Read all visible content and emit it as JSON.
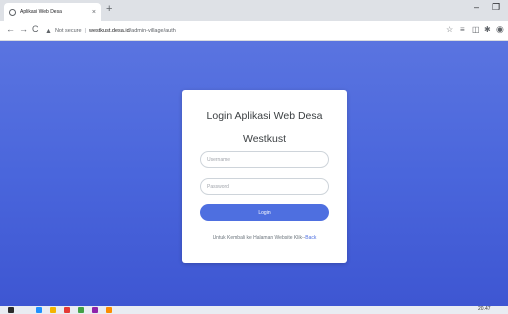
{
  "tab": {
    "title": "Aplikasi Web Desa",
    "close": "×",
    "new_tab": "+"
  },
  "window": {
    "minimize": "–",
    "restore": "❐"
  },
  "toolbar": {
    "back": "←",
    "forward": "→",
    "reload": "C",
    "security_icon": "▲",
    "security_text": "Not secure",
    "url_host": "westkust.desa.id",
    "url_path": "/admin-village/auth",
    "icons": [
      "star-icon",
      "media-icon",
      "extension-icon",
      "puzzle-icon",
      "profile-icon"
    ]
  },
  "login": {
    "title_line1": "Login Aplikasi Web Desa",
    "title_line2": "Westkust",
    "username_placeholder": "Username",
    "password_placeholder": "Password",
    "login_button": "Login",
    "back_text": "Untuk Kembali ke Halaman Website Klik--",
    "back_link": "Back"
  },
  "taskbar": {
    "time": "20.47"
  },
  "colors": {
    "accent": "#4e6fe0",
    "background_top": "#5a74e0",
    "background_bottom": "#3e56d2"
  }
}
